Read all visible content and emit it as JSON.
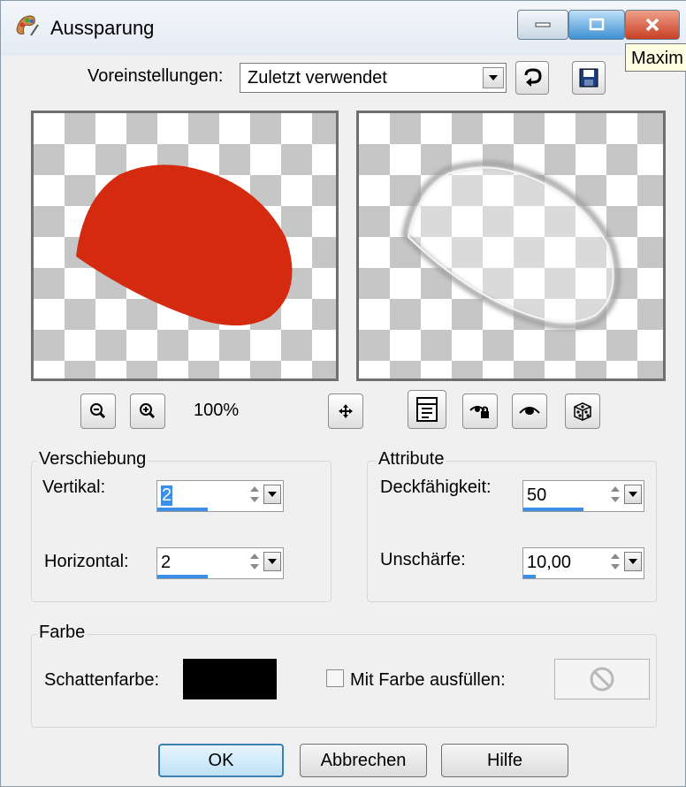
{
  "window": {
    "title": "Aussparung",
    "tooltip": "Maxim"
  },
  "preset": {
    "label": "Voreinstellungen:",
    "value": "Zuletzt verwendet"
  },
  "zoom": {
    "level": "100%"
  },
  "offset_group": {
    "title": "Verschiebung",
    "vertical_label": "Vertikal:",
    "vertical_value": "2",
    "vertical_fill": 0.4,
    "horizontal_label": "Horizontal:",
    "horizontal_value": "2",
    "horizontal_fill": 0.4
  },
  "attrib_group": {
    "title": "Attribute",
    "opacity_label": "Deckfähigkeit:",
    "opacity_value": "50",
    "opacity_fill": 0.5,
    "blur_label": "Unschärfe:",
    "blur_value": "10,00",
    "blur_fill": 0.1
  },
  "color_group": {
    "title": "Farbe",
    "shadow_label": "Schattenfarbe:",
    "shadow_color": "#000000",
    "fill_label": "Mit Farbe ausfüllen:",
    "fill_checked": false
  },
  "buttons": {
    "ok": "OK",
    "cancel": "Abbrechen",
    "help": "Hilfe"
  },
  "colors": {
    "shape_red": "#d42a0f",
    "accent_blue": "#3d8ee6"
  }
}
